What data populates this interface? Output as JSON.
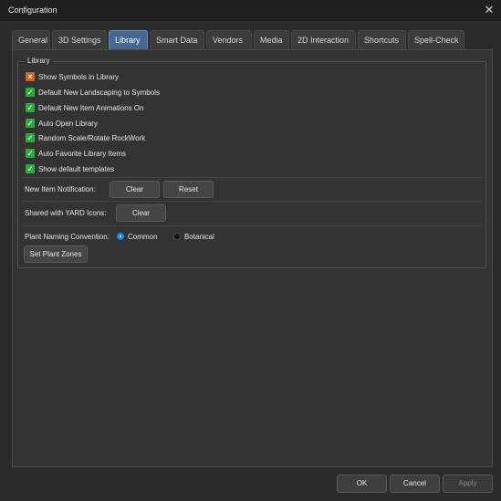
{
  "window": {
    "title": "Configuration"
  },
  "tabs": [
    {
      "label": "General"
    },
    {
      "label": "3D Settings"
    },
    {
      "label": "Library",
      "active": true
    },
    {
      "label": "Smart Data"
    },
    {
      "label": "Vendors"
    },
    {
      "label": "Media"
    },
    {
      "label": "2D Interaction"
    },
    {
      "label": "Shortcuts"
    },
    {
      "label": "Spell-Check"
    }
  ],
  "library": {
    "group_title": "Library",
    "options": [
      {
        "label": "Show Symbols in Library",
        "state": "partial"
      },
      {
        "label": "Default New Landscaping to Symbols",
        "state": "checked"
      },
      {
        "label": "Default New Item Animations On",
        "state": "checked"
      },
      {
        "label": "Auto Open Library",
        "state": "checked"
      },
      {
        "label": "Random Scale/Rotate RockWork",
        "state": "checked"
      },
      {
        "label": "Auto Favorite Library Items",
        "state": "checked"
      },
      {
        "label": "Show default templates",
        "state": "checked"
      }
    ],
    "new_item_notification": {
      "label": "New Item Notification:",
      "clear": "Clear",
      "reset": "Reset"
    },
    "shared_yard_icons": {
      "label": "Shared with YARD Icons:",
      "clear": "Clear"
    },
    "plant_naming": {
      "label": "Plant Naming Convention:",
      "options": [
        {
          "label": "Common",
          "selected": true
        },
        {
          "label": "Botanical",
          "selected": false
        }
      ]
    },
    "set_plant_zones": "Set Plant Zones"
  },
  "footer": {
    "ok": "OK",
    "cancel": "Cancel",
    "apply": "Apply"
  },
  "colors": {
    "accent": "#46678f",
    "checkbox": "#2fa83f",
    "partial": "#d0621b",
    "radio": "#1e88e5"
  }
}
